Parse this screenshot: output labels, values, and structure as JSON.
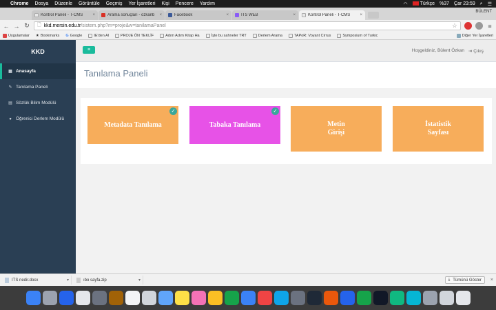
{
  "menubar": {
    "app": "Chrome",
    "items": [
      "Dosya",
      "Düzenle",
      "Görüntüle",
      "Geçmiş",
      "Yer İşaretleri",
      "Kişi",
      "Pencere",
      "Yardım"
    ],
    "language": "Türkçe",
    "battery": "%37",
    "clock": "Çar 23:59"
  },
  "tabs": [
    {
      "label": "Kontrol Paneli - T-CMS",
      "color": "#ffffff"
    },
    {
      "label": "Arama sonuçları - ozkanb",
      "color": "#d93025"
    },
    {
      "label": "Facebook",
      "color": "#3b5998"
    },
    {
      "label": "ITS WEB",
      "color": "#8a5cf6"
    },
    {
      "label": "Kontrol Paneli - T-CMS",
      "color": "#ffffff"
    }
  ],
  "profile_name": "BÜLENT",
  "url": {
    "domain": "kkd.mersin.edu.tr",
    "path": "/sistem.php?m=proje&w=tanilamaPanel"
  },
  "bookmarks": [
    "Uygulamalar",
    "Bookmarks",
    "Google",
    "IE'den Al",
    "PROJE ÖN TEKLİF",
    "Adım Adım Kitap Ha",
    "İşte bu sahneler TRT",
    "Derlem Arama",
    "TAPoR: Voyant Cirrus",
    "Symposium of Turkic"
  ],
  "bookmarks_other": "Diğer Yer İşaretleri",
  "sidebar": {
    "brand": "KKD",
    "items": [
      {
        "label": "Anasayfa",
        "icon": "grid-icon"
      },
      {
        "label": "Tanılama Paneli",
        "icon": "pencil-icon"
      },
      {
        "label": "Sözlük Bilim Modülü",
        "icon": "book-icon"
      },
      {
        "label": "Öğrenici Derlem Modülü",
        "icon": "user-icon"
      }
    ]
  },
  "topnav": {
    "menu_icon": "≡",
    "welcome": "Hoşgeldiniz, Bülent Özkan",
    "logout": "Çıkış"
  },
  "page_title": "Tanılama Paneli",
  "cards": [
    {
      "label": "Metadata Tanılama",
      "color": "#f7ad5b",
      "checked": true
    },
    {
      "label": "Tabaka Tanılama",
      "color": "#e752e7",
      "checked": true
    },
    {
      "label": "Metin Girişi",
      "color": "#f7ad5b",
      "checked": false
    },
    {
      "label": "İstatistik Sayfası",
      "color": "#f7ad5b",
      "checked": false
    }
  ],
  "downloads": [
    {
      "name": "ITS nedir.docx"
    },
    {
      "name": "ıbo sayfa.zip"
    }
  ],
  "show_all": "Tümünü Göster"
}
